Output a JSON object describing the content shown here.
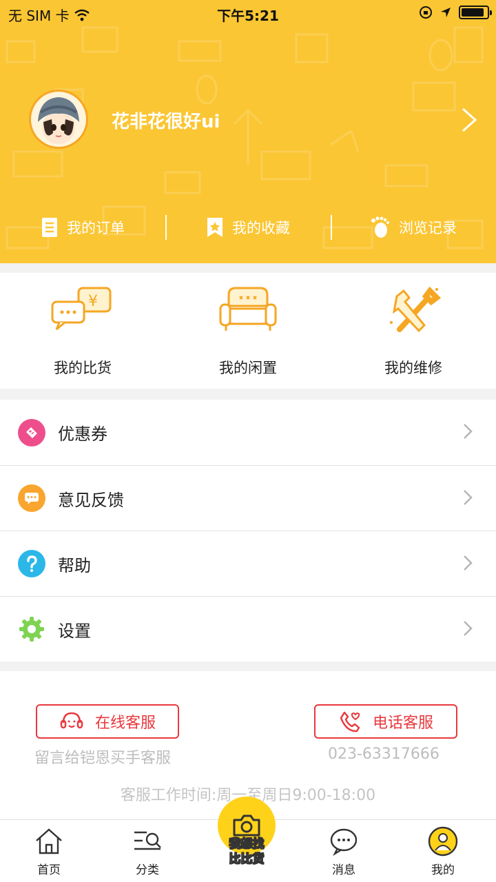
{
  "status_bar": {
    "carrier": "无 SIM 卡",
    "time": "下午5:21",
    "battery_level": 0.9
  },
  "profile": {
    "username": "花非花很好ui"
  },
  "quick_links": [
    {
      "label": "我的订单",
      "icon": "document-icon"
    },
    {
      "label": "我的收藏",
      "icon": "bookmark-star-icon"
    },
    {
      "label": "浏览记录",
      "icon": "footprint-icon"
    }
  ],
  "features": [
    {
      "label": "我的比货",
      "icon": "chat-price-icon"
    },
    {
      "label": "我的闲置",
      "icon": "sofa-icon"
    },
    {
      "label": "我的维修",
      "icon": "tools-icon"
    }
  ],
  "menu": [
    {
      "label": "优惠券",
      "icon": "coupon-icon",
      "color": "#ee4f8c"
    },
    {
      "label": "意见反馈",
      "icon": "feedback-icon",
      "color": "#f9a52e"
    },
    {
      "label": "帮助",
      "icon": "help-icon",
      "color": "#2bb7e8"
    },
    {
      "label": "设置",
      "icon": "settings-icon",
      "color": "#7fd352"
    }
  ],
  "service": {
    "online_label": "在线客服",
    "online_sub": "留言给铠恩买手客服",
    "phone_label": "电话客服",
    "phone_sub": "023-63317666",
    "hours": "客服工作时间:周一至周日9:00-18:00"
  },
  "tabbar": {
    "home": "首页",
    "category": "分类",
    "center_line1": "我想找",
    "center_line2": "比比货",
    "messages": "消息",
    "mine": "我的"
  },
  "colors": {
    "header_bg": "#fbc633",
    "accent_red": "#e8383d",
    "center_button": "#ffd21a"
  }
}
